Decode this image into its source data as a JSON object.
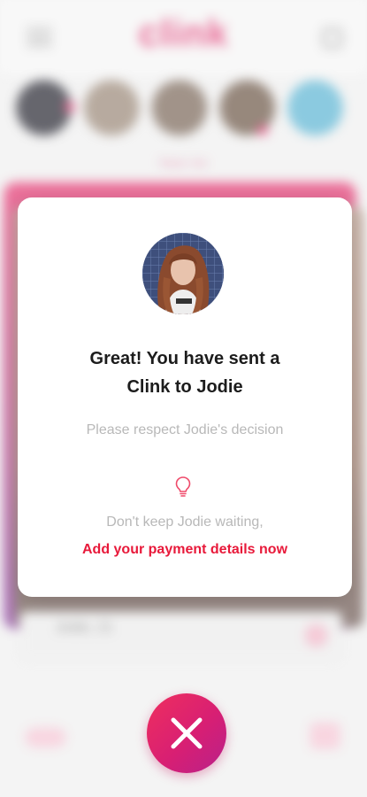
{
  "background": {
    "app_name": "clink",
    "filter_label": "Near me",
    "card_name": "Jodie, 21"
  },
  "modal": {
    "title_line1": "Great! You have sent a",
    "title_line2": "Clink to Jodie",
    "subtitle": "Please respect Jodie's decision",
    "waiting_text": "Don't keep Jodie waiting,",
    "payment_link": "Add your payment details now",
    "avatar_icon": "profile-photo",
    "tip_icon": "lightbulb-icon"
  },
  "close_button": {
    "icon": "close-icon"
  },
  "colors": {
    "brand": "#e0336f",
    "link": "#e8193a",
    "muted_text": "#b8b8b8"
  }
}
